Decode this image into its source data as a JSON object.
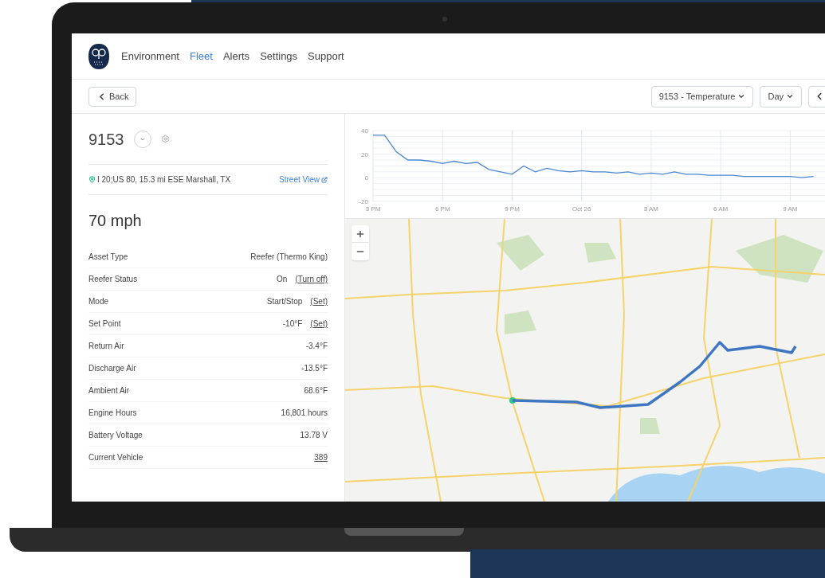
{
  "nav": {
    "items": [
      {
        "label": "Environment",
        "selected": false
      },
      {
        "label": "Fleet",
        "selected": true
      },
      {
        "label": "Alerts",
        "selected": false
      },
      {
        "label": "Settings",
        "selected": false
      },
      {
        "label": "Support",
        "selected": false
      }
    ]
  },
  "toolbar": {
    "back": "Back",
    "metric_dropdown": "9153 - Temperature",
    "range_dropdown": "Day"
  },
  "asset": {
    "id": "9153",
    "location": "I 20;US 80, 15.3 mi ESE Marshall, TX",
    "street_view": "Street View",
    "speed": "70 mph"
  },
  "details": [
    {
      "label": "Asset Type",
      "value": "Reefer (Thermo King)"
    },
    {
      "label": "Reefer Status",
      "value": "On",
      "action": "(Turn off)"
    },
    {
      "label": "Mode",
      "value": "Start/Stop",
      "action": "(Set)"
    },
    {
      "label": "Set Point",
      "value": "-10°F",
      "action": "(Set)"
    },
    {
      "label": "Return Air",
      "value": "-3.4°F"
    },
    {
      "label": "Discharge Air",
      "value": "-13.5°F"
    },
    {
      "label": "Ambient Air",
      "value": "68.6°F"
    },
    {
      "label": "Engine Hours",
      "value": "16,801 hours"
    },
    {
      "label": "Battery Voltage",
      "value": "13.78 V"
    },
    {
      "label": "Current Vehicle",
      "link": "389"
    }
  ],
  "chart": {
    "chart_data": {
      "type": "line",
      "categories": [
        "3 PM",
        null,
        null,
        null,
        null,
        null,
        "6 PM",
        null,
        null,
        null,
        null,
        null,
        "9 PM",
        null,
        null,
        null,
        null,
        null,
        "Oct 26",
        null,
        null,
        null,
        null,
        null,
        "3 AM",
        null,
        null,
        null,
        null,
        null,
        "6 AM",
        null,
        null,
        null,
        null,
        null,
        "9 AM",
        null,
        null
      ],
      "series": [
        {
          "color": "#4a86d0",
          "values": [
            36,
            36,
            22,
            15,
            15,
            14,
            12,
            14,
            12,
            13,
            7,
            5,
            3,
            10,
            5,
            8,
            6,
            5,
            6,
            5,
            5,
            4,
            5,
            3,
            4,
            3,
            5,
            3,
            3,
            2,
            2,
            2,
            1,
            1,
            1,
            1,
            1,
            0,
            1
          ]
        }
      ],
      "ylim": [
        -20,
        40
      ],
      "yticks": [
        40,
        20,
        0,
        -20
      ],
      "grid": true
    }
  }
}
